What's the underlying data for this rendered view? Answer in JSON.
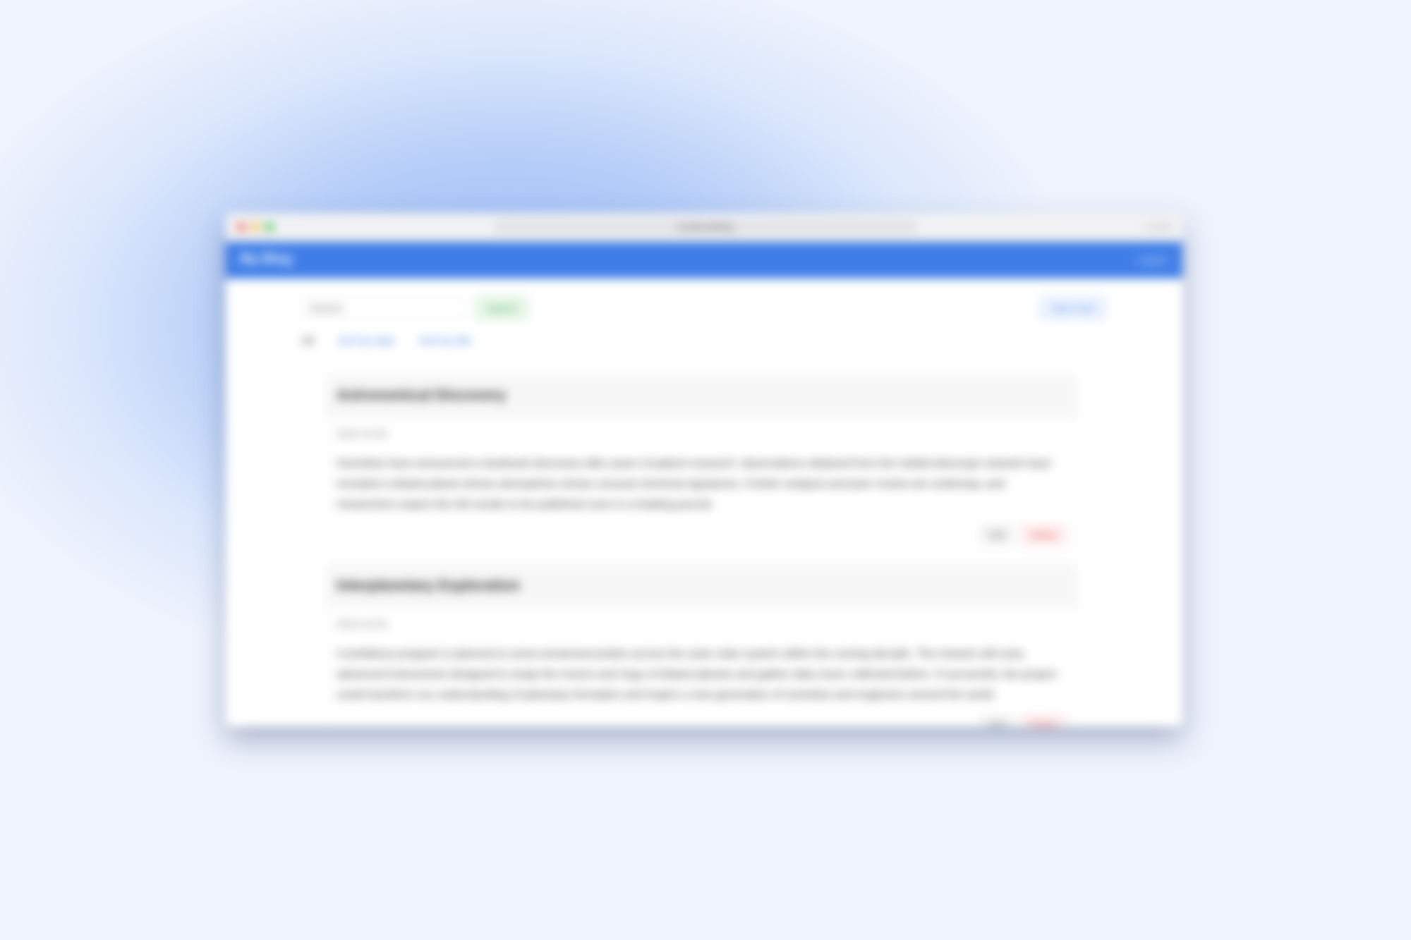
{
  "browser": {
    "url": "localhost/blog",
    "window_controls": "— ▢ ✕"
  },
  "app": {
    "brand": "My Blog",
    "user_menu": "Logout"
  },
  "toolbar": {
    "search_placeholder": "Search",
    "search_label": "Search",
    "new_post_label": "New Post"
  },
  "filters": {
    "all_label": "All",
    "links": [
      "Sort by date",
      "Sort by title"
    ]
  },
  "posts": [
    {
      "title": "Astronomical Discovery",
      "date": "2023-10-05",
      "body": "Scientists have announced a landmark discovery after years of patient research: observations obtained from the orbital telescope network have revealed a distant planet whose atmosphere shows unusual chemical signatures. Further analysis and peer review are underway, and researchers expect the full results to be published soon in a leading journal.",
      "edit_label": "Edit",
      "delete_label": "Delete"
    },
    {
      "title": "Interplanetary Exploration",
      "date": "2023-10-03",
      "body": "A ambitious program is planned to send unmanned probes across the outer solar system within the coming decade. The mission will carry advanced instruments designed to study the moons and rings of distant planets and gather data never collected before. If successful, the project could transform our understanding of planetary formation and inspire a new generation of scientists and engineers around the world.",
      "edit_label": "Edit",
      "delete_label": "Delete"
    }
  ]
}
